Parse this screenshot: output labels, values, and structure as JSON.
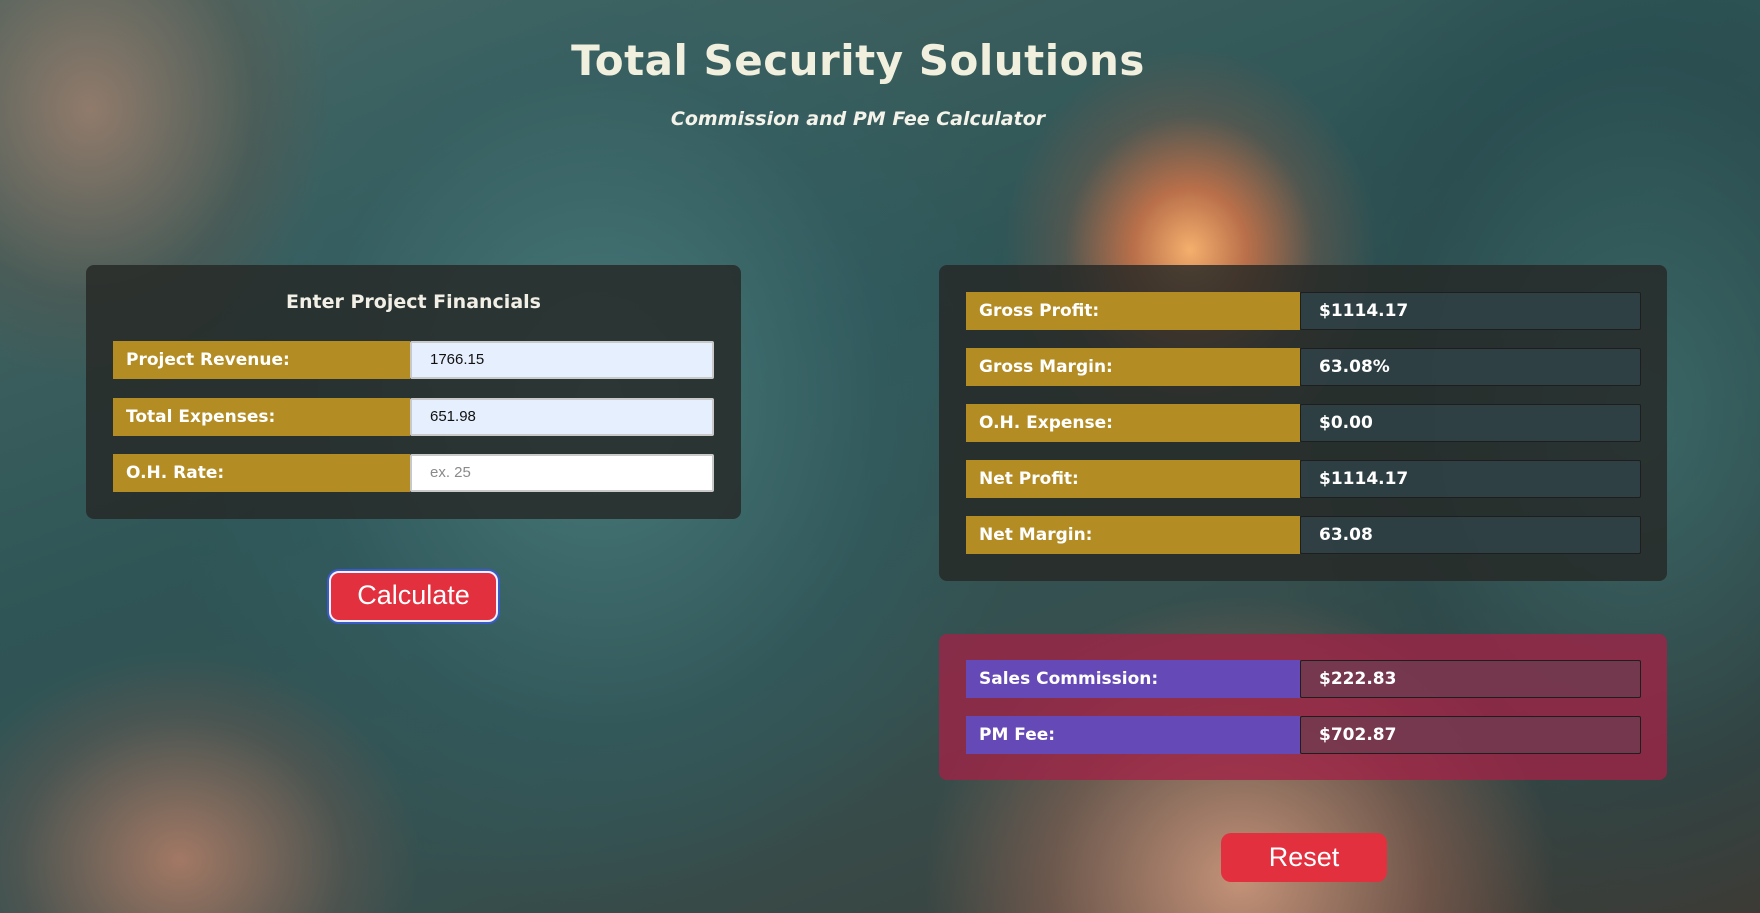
{
  "header": {
    "title": "Total Security Solutions",
    "subtitle": "Commission and PM Fee Calculator"
  },
  "inputs": {
    "heading": "Enter Project Financials",
    "fields": [
      {
        "label": "Project Revenue:",
        "value": "1766.15",
        "placeholder": ""
      },
      {
        "label": "Total Expenses:",
        "value": "651.98",
        "placeholder": ""
      },
      {
        "label": "O.H. Rate:",
        "value": "",
        "placeholder": "ex. 25"
      }
    ],
    "calculate_label": "Calculate"
  },
  "results": [
    {
      "label": "Gross Profit:",
      "value": "$1114.17"
    },
    {
      "label": "Gross Margin:",
      "value": "63.08%"
    },
    {
      "label": "O.H. Expense:",
      "value": "$0.00"
    },
    {
      "label": "Net Profit:",
      "value": "$1114.17"
    },
    {
      "label": "Net Margin:",
      "value": "63.08"
    }
  ],
  "commission": [
    {
      "label": "Sales Commission:",
      "value": "$222.83"
    },
    {
      "label": "PM Fee:",
      "value": "$702.87"
    }
  ],
  "reset_label": "Reset",
  "colors": {
    "label_gold": "#b48c24",
    "label_purple": "#6549b6",
    "button_red": "#e2303f",
    "commission_panel": "#a02346"
  }
}
